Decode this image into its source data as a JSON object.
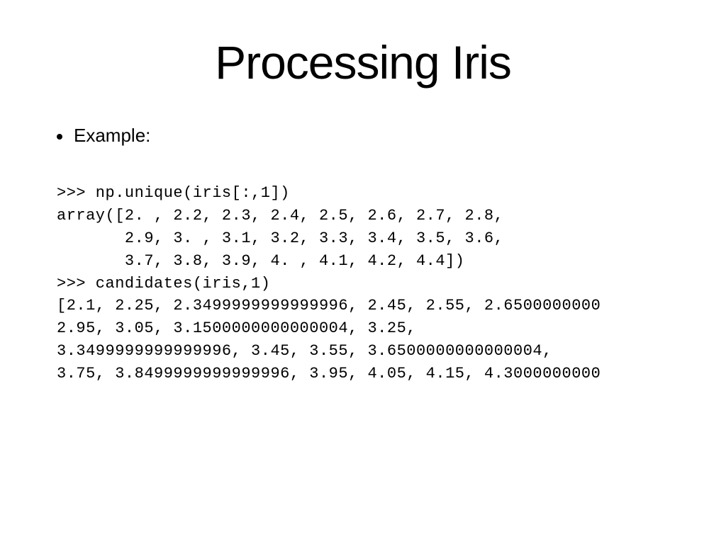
{
  "slide": {
    "title": "Processing Iris",
    "bullet_label": "Example:",
    "code": ">>> np.unique(iris[:,1])\narray([2. , 2.2, 2.3, 2.4, 2.5, 2.6, 2.7, 2.8,\n       2.9, 3. , 3.1, 3.2, 3.3, 3.4, 3.5, 3.6,\n       3.7, 3.8, 3.9, 4. , 4.1, 4.2, 4.4])\n>>> candidates(iris,1)\n[2.1, 2.25, 2.3499999999999996, 2.45, 2.55, 2.6500000000\n2.95, 3.05, 3.1500000000000004, 3.25,\n3.3499999999999996, 3.45, 3.55, 3.6500000000000004,\n3.75, 3.8499999999999996, 3.95, 4.05, 4.15, 4.3000000000"
  }
}
